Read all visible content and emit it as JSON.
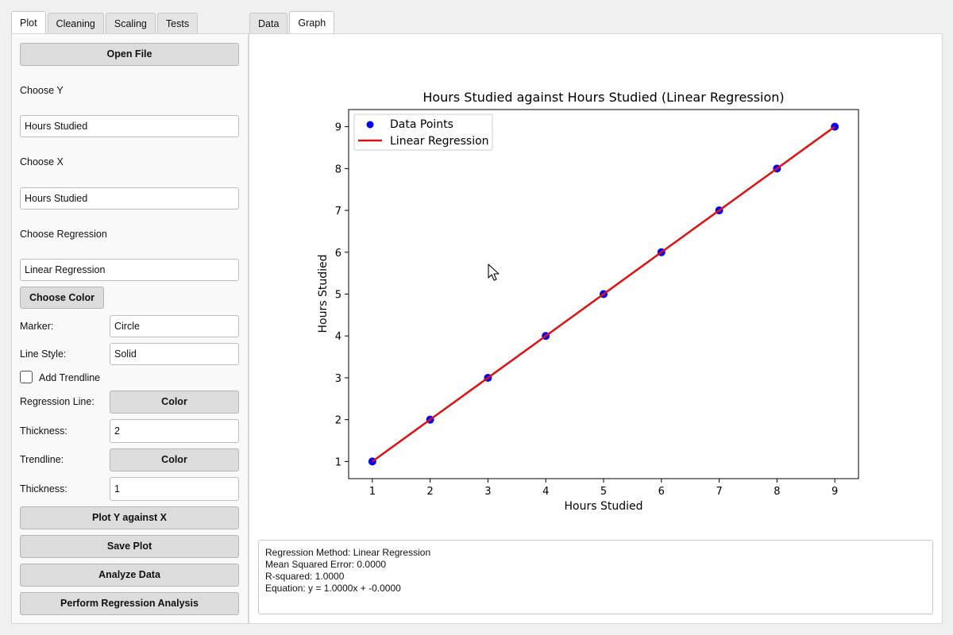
{
  "left_tabs": [
    "Plot",
    "Cleaning",
    "Scaling",
    "Tests"
  ],
  "right_tabs": [
    "Data",
    "Graph"
  ],
  "controls": {
    "open_file": "Open File",
    "choose_y_label": "Choose Y",
    "choose_y_value": "Hours Studied",
    "choose_x_label": "Choose X",
    "choose_x_value": "Hours Studied",
    "choose_regression_label": "Choose Regression",
    "choose_regression_value": "Linear Regression",
    "choose_color": "Choose Color",
    "marker_label": "Marker:",
    "marker_value": "Circle",
    "line_style_label": "Line Style:",
    "line_style_value": "Solid",
    "add_trendline_label": "Add Trendline",
    "regression_line_label": "Regression Line:",
    "regression_color_btn": "Color",
    "thickness1_label": "Thickness:",
    "thickness1_value": "2",
    "trendline_label": "Trendline:",
    "trendline_color_btn": "Color",
    "thickness2_label": "Thickness:",
    "thickness2_value": "1",
    "plot_btn": "Plot Y against X",
    "save_btn": "Save Plot",
    "analyze_btn": "Analyze Data",
    "regression_btn": "Perform Regression Analysis"
  },
  "chart_data": {
    "type": "scatter",
    "title": "Hours Studied against Hours Studied (Linear Regression)",
    "xlabel": "Hours Studied",
    "ylabel": "Hours Studied",
    "x": [
      1,
      2,
      3,
      4,
      5,
      6,
      7,
      8,
      9
    ],
    "series": [
      {
        "name": "Data Points",
        "values": [
          1,
          2,
          3,
          4,
          5,
          6,
          7,
          8,
          9
        ],
        "color": "#0000ff",
        "kind": "scatter"
      },
      {
        "name": "Linear Regression",
        "values": [
          1,
          2,
          3,
          4,
          5,
          6,
          7,
          8,
          9
        ],
        "color": "#e01010",
        "kind": "line"
      }
    ],
    "xticks": [
      1,
      2,
      3,
      4,
      5,
      6,
      7,
      8,
      9
    ],
    "yticks": [
      1,
      2,
      3,
      4,
      5,
      6,
      7,
      8,
      9
    ],
    "xlim": [
      0.59,
      9.41
    ],
    "ylim": [
      0.59,
      9.41
    ],
    "legend_position": "top-left",
    "grid": false
  },
  "results": {
    "method": "Regression Method: Linear Regression",
    "mse": "Mean Squared Error: 0.0000",
    "r2": "R-squared: 1.0000",
    "equation": "Equation: y = 1.0000x + -0.0000"
  }
}
